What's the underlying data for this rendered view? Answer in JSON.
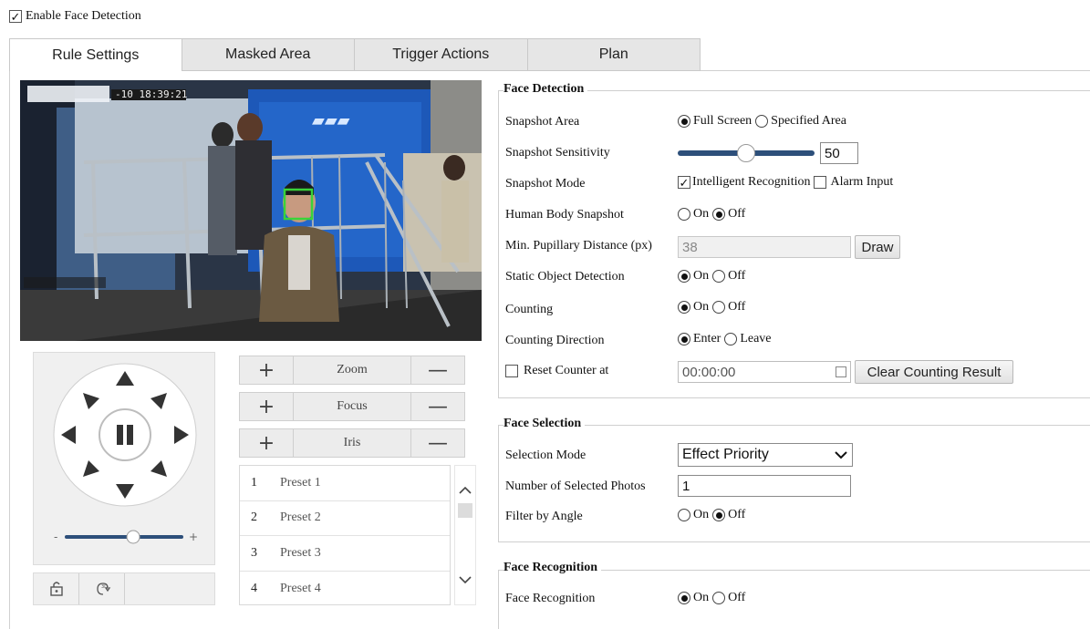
{
  "enable_face_detection": {
    "label": "Enable Face Detection",
    "checked": true
  },
  "tabs": [
    {
      "label": "Rule Settings",
      "active": true
    },
    {
      "label": "Masked Area",
      "active": false
    },
    {
      "label": "Trigger Actions",
      "active": false
    },
    {
      "label": "Plan",
      "active": false
    }
  ],
  "video": {
    "timestamp": "-10 18:39:21",
    "face_box_color": "#39d339"
  },
  "ptz": {
    "zoom_label": "Zoom",
    "focus_label": "Focus",
    "iris_label": "Iris",
    "plus": "+",
    "minus": "—",
    "speed_fraction": 0.58
  },
  "presets": [
    {
      "num": "1",
      "name": "Preset 1"
    },
    {
      "num": "2",
      "name": "Preset 2"
    },
    {
      "num": "3",
      "name": "Preset 3"
    },
    {
      "num": "4",
      "name": "Preset 4"
    }
  ],
  "face_detection": {
    "title": "Face Detection",
    "snapshot_area": {
      "label": "Snapshot Area",
      "options": [
        "Full Screen",
        "Specified Area"
      ],
      "selected": "Full Screen"
    },
    "snapshot_sensitivity": {
      "label": "Snapshot Sensitivity",
      "value": "50",
      "fraction": 0.5
    },
    "snapshot_mode": {
      "label": "Snapshot Mode",
      "intelligent_recognition": "Intelligent Recognition",
      "alarm_input": "Alarm Input",
      "intelligent_checked": true,
      "alarm_checked": false
    },
    "human_body_snapshot": {
      "label": "Human Body Snapshot",
      "on": "On",
      "off": "Off",
      "selected": "Off"
    },
    "min_pupillary": {
      "label": "Min. Pupillary Distance (px)",
      "value": "38",
      "draw_button": "Draw"
    },
    "static_object_detection": {
      "label": "Static Object Detection",
      "on": "On",
      "off": "Off",
      "selected": "On"
    },
    "counting": {
      "label": "Counting",
      "on": "On",
      "off": "Off",
      "selected": "On"
    },
    "counting_direction": {
      "label": "Counting Direction",
      "enter": "Enter",
      "leave": "Leave",
      "selected": "Enter"
    },
    "reset_counter": {
      "label": "Reset Counter at",
      "time": "00:00:00",
      "clear_button": "Clear Counting Result",
      "checked": false
    }
  },
  "face_selection": {
    "title": "Face Selection",
    "selection_mode": {
      "label": "Selection Mode",
      "value": "Effect Priority"
    },
    "selected_photos": {
      "label": "Number of Selected Photos",
      "value": "1"
    },
    "filter_by_angle": {
      "label": "Filter by Angle",
      "on": "On",
      "off": "Off",
      "selected": "Off"
    }
  },
  "face_recognition": {
    "title": "Face Recognition",
    "face_recognition": {
      "label": "Face Recognition",
      "on": "On",
      "off": "Off",
      "selected": "On"
    }
  },
  "icons": {
    "lock": "lock-icon",
    "3d_positioning": "3d-positioning-icon",
    "calendar": "calendar-icon",
    "chevron_down": "chevron-down-icon",
    "scroll_up": "scroll-up-icon",
    "scroll_down": "scroll-down-icon",
    "pause": "pause-icon"
  }
}
